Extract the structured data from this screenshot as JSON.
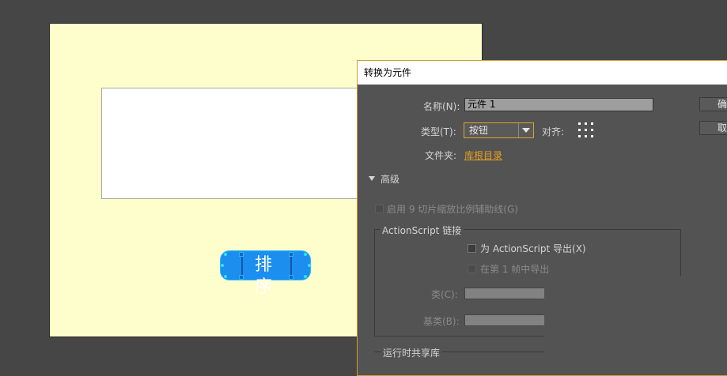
{
  "stage": {
    "button_label": "排 序"
  },
  "dialog": {
    "title": "转换为元件",
    "name_label": "名称(N):",
    "name_value": "元件 1",
    "type_label": "类型(T):",
    "type_value": "按钮",
    "align_label": "对齐:",
    "folder_label": "文件夹:",
    "folder_value": "库根目录",
    "advanced_label": "高级",
    "scale9_label": "启用 9 切片缩放比例辅助线(G)",
    "as_group_title": "ActionScript 链接",
    "export_as_label": "为 ActionScript 导出(X)",
    "export_frame_label": "在第 1 帧中导出",
    "class_label": "类(C):",
    "base_class_label": "基类(B):",
    "runtime_group_title": "运行时共享库",
    "ok_label": "确",
    "cancel_label": "取"
  },
  "colors": {
    "workspace_bg": "#464646",
    "stage_bg": "#fefdcc",
    "dialog_bg": "#535353",
    "accent_orange": "#e8a020",
    "button_blue": "#1c8ef0"
  }
}
